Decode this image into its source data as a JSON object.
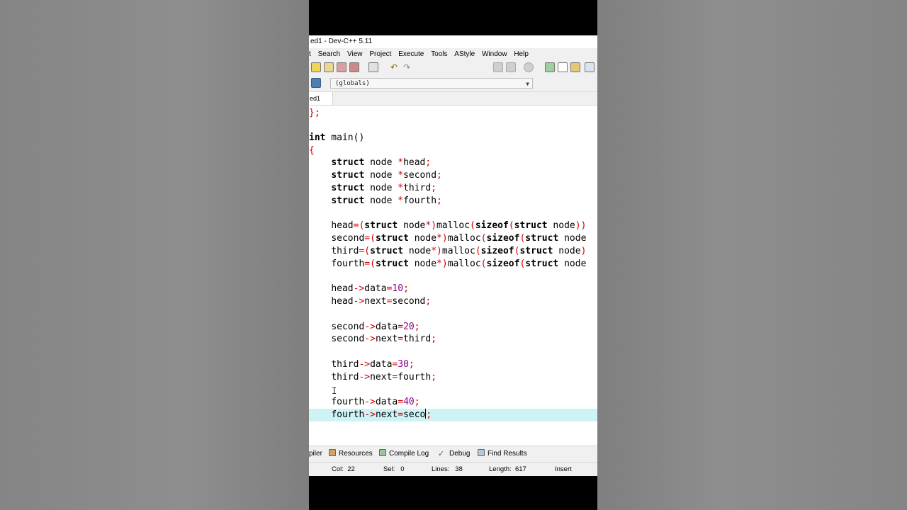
{
  "window": {
    "title": "ed1 - Dev-C++ 5.11"
  },
  "menu": [
    "t",
    "Search",
    "View",
    "Project",
    "Execute",
    "Tools",
    "AStyle",
    "Window",
    "Help"
  ],
  "scope_selector": {
    "value": "(globals)"
  },
  "tabs": [
    {
      "label": "ed1"
    }
  ],
  "code": {
    "l0": "};",
    "l2a": "int",
    "l2b": " main()",
    "l3": "{",
    "decl_kw": "struct",
    "decl_type": " node ",
    "decl_star": "*",
    "decl_semi": ";",
    "d1": "head",
    "d2": "second",
    "d3": "third",
    "d4": "fourth",
    "m_eq": "=(",
    "m_node": " node",
    "m_star": "*)",
    "m_malloc": "malloc",
    "m_paren": "(",
    "m_sizeof": "sizeof",
    "m1_end": "))",
    "m3_end": ")",
    "arrow": "->",
    "f_data": "data",
    "f_next": "next",
    "eq": "=",
    "v10": "10",
    "v20": "20",
    "v30": "30",
    "v40": "40",
    "n_second": "second",
    "n_third": "third",
    "n_fourth": "fourth",
    "typed": "seco"
  },
  "bottom_tabs": [
    "piler",
    "Resources",
    "Compile Log",
    "Debug",
    "Find Results"
  ],
  "status": {
    "col_label": "Col:",
    "col": "22",
    "sel_label": "Sel:",
    "sel": "0",
    "lines_label": "Lines:",
    "lines": "38",
    "length_label": "Length:",
    "length": "617",
    "mode": "Insert"
  },
  "colors": {
    "keyword": "#000000",
    "operator": "#d40000",
    "number": "#8b008b",
    "current_line": "#cdf3f6"
  }
}
